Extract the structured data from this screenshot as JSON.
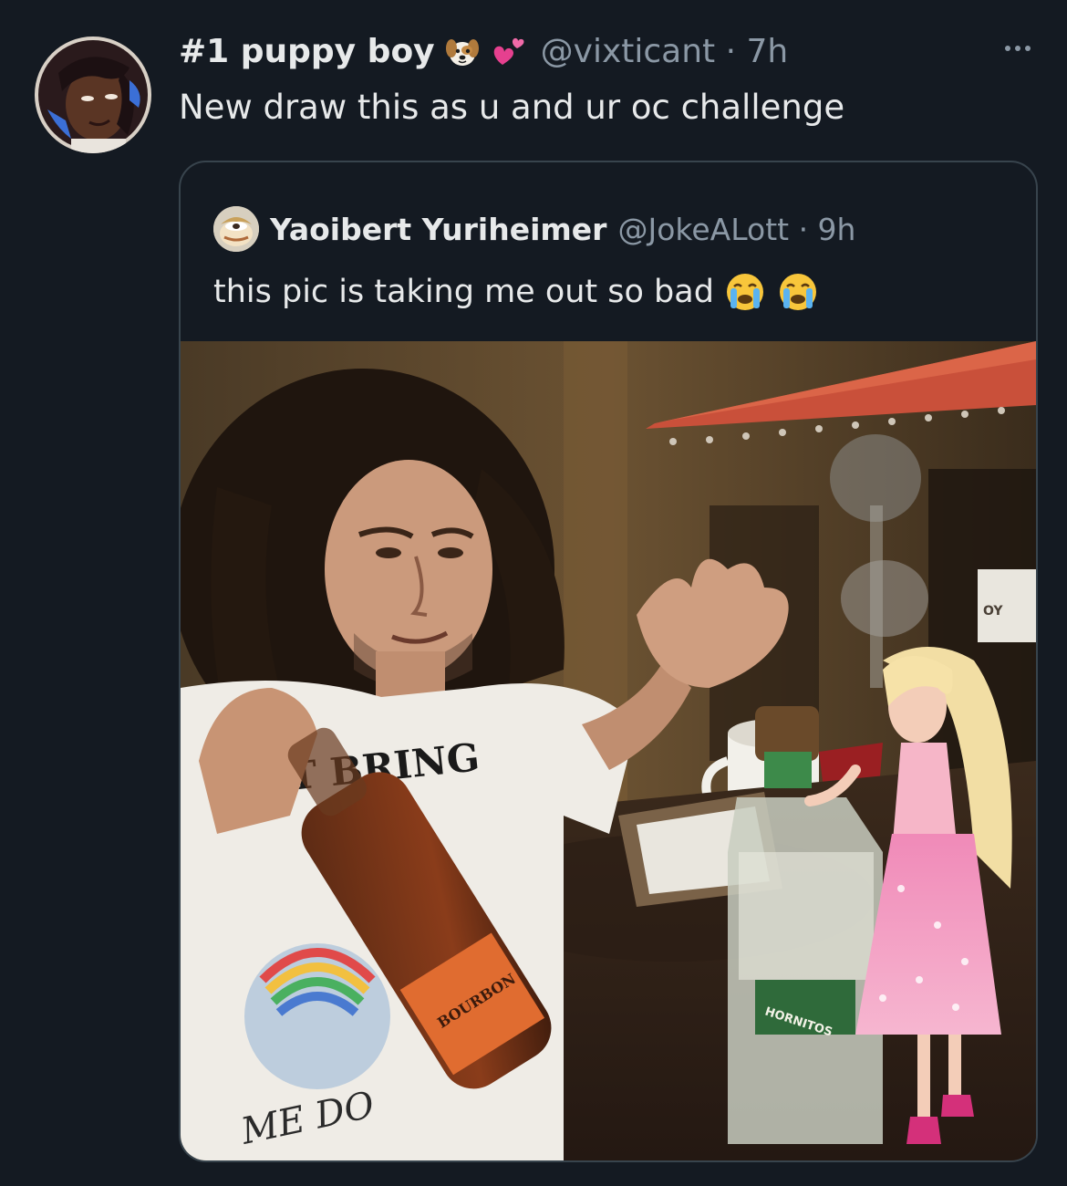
{
  "tweet": {
    "display_name": "#1 puppy boy",
    "handle_time": "@vixticant · 7h",
    "text": "New draw this as u and ur oc challenge"
  },
  "quote": {
    "display_name": "Yaoibert Yuriheimer",
    "handle_time": "@JokeALott · 9h",
    "text": "this pic is taking me out so bad",
    "image": {
      "shirt_text": "T BRING",
      "shirt_text_bottom": "ME DO",
      "bourbon_label": "BOURBON",
      "tequila_label": "HORNITOS",
      "mug_text": "OY"
    }
  },
  "icons": {
    "name_emoji_1": "puppy-face-icon",
    "name_emoji_2": "two-hearts-icon",
    "quote_emoji": "loudly-crying-face-icon",
    "menu": "more-icon"
  },
  "colors": {
    "background": "#141a22",
    "text_primary": "#e7e9ea",
    "text_secondary": "#8b98a5",
    "card_border": "#38444d"
  }
}
